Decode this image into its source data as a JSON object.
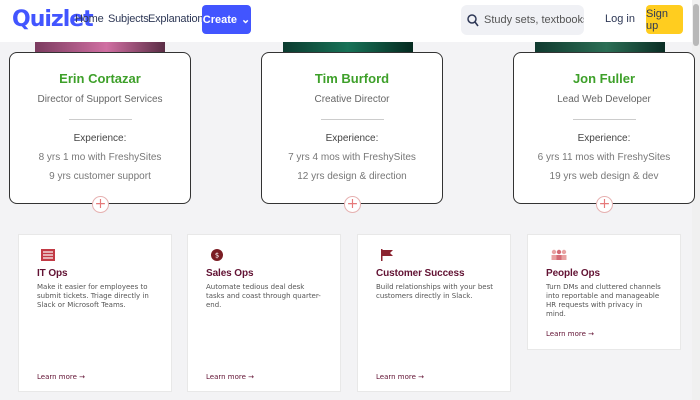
{
  "nav": {
    "logo": "Quizlet",
    "links": [
      "Home",
      "Subjects",
      "Explanations"
    ],
    "create": "Create",
    "search_placeholder": "Study sets, textbooks, ...",
    "login": "Log in",
    "signup": "Sign up"
  },
  "people": [
    {
      "name": "Erin Cortazar",
      "role": "Director of Support Services",
      "experience_label": "Experience:",
      "lines": [
        "8 yrs 1 mo with FreshySites",
        "9 yrs customer support"
      ]
    },
    {
      "name": "Tim Burford",
      "role": "Creative Director",
      "experience_label": "Experience:",
      "lines": [
        "7 yrs 4 mos with FreshySites",
        "12 yrs design & direction"
      ]
    },
    {
      "name": "Jon Fuller",
      "role": "Lead Web Developer",
      "experience_label": "Experience:",
      "lines": [
        "6 yrs 11 mos with FreshySites",
        "19 yrs web design & dev"
      ]
    }
  ],
  "features": [
    {
      "title": "IT Ops",
      "desc": "Make it easier for employees to submit tickets. Triage directly in Slack or Microsoft Teams.",
      "link": "Learn more →",
      "icon": "list-icon"
    },
    {
      "title": "Sales Ops",
      "desc": "Automate tedious deal desk tasks and coast through quarter-end.",
      "link": "Learn more →",
      "icon": "dollar-icon"
    },
    {
      "title": "Customer Success",
      "desc": "Build relationships with your best customers directly in Slack.",
      "link": "Learn more →",
      "icon": "flag-icon"
    },
    {
      "title": "People Ops",
      "desc": "Turn DMs and cluttered channels into reportable and manageable HR requests with privacy in mind.",
      "link": "Learn more →",
      "icon": "people-icon"
    }
  ],
  "colors": {
    "brand": "#4255ff",
    "green": "#3ea02a",
    "maroon": "#621233",
    "signup": "#ffcd1f"
  }
}
